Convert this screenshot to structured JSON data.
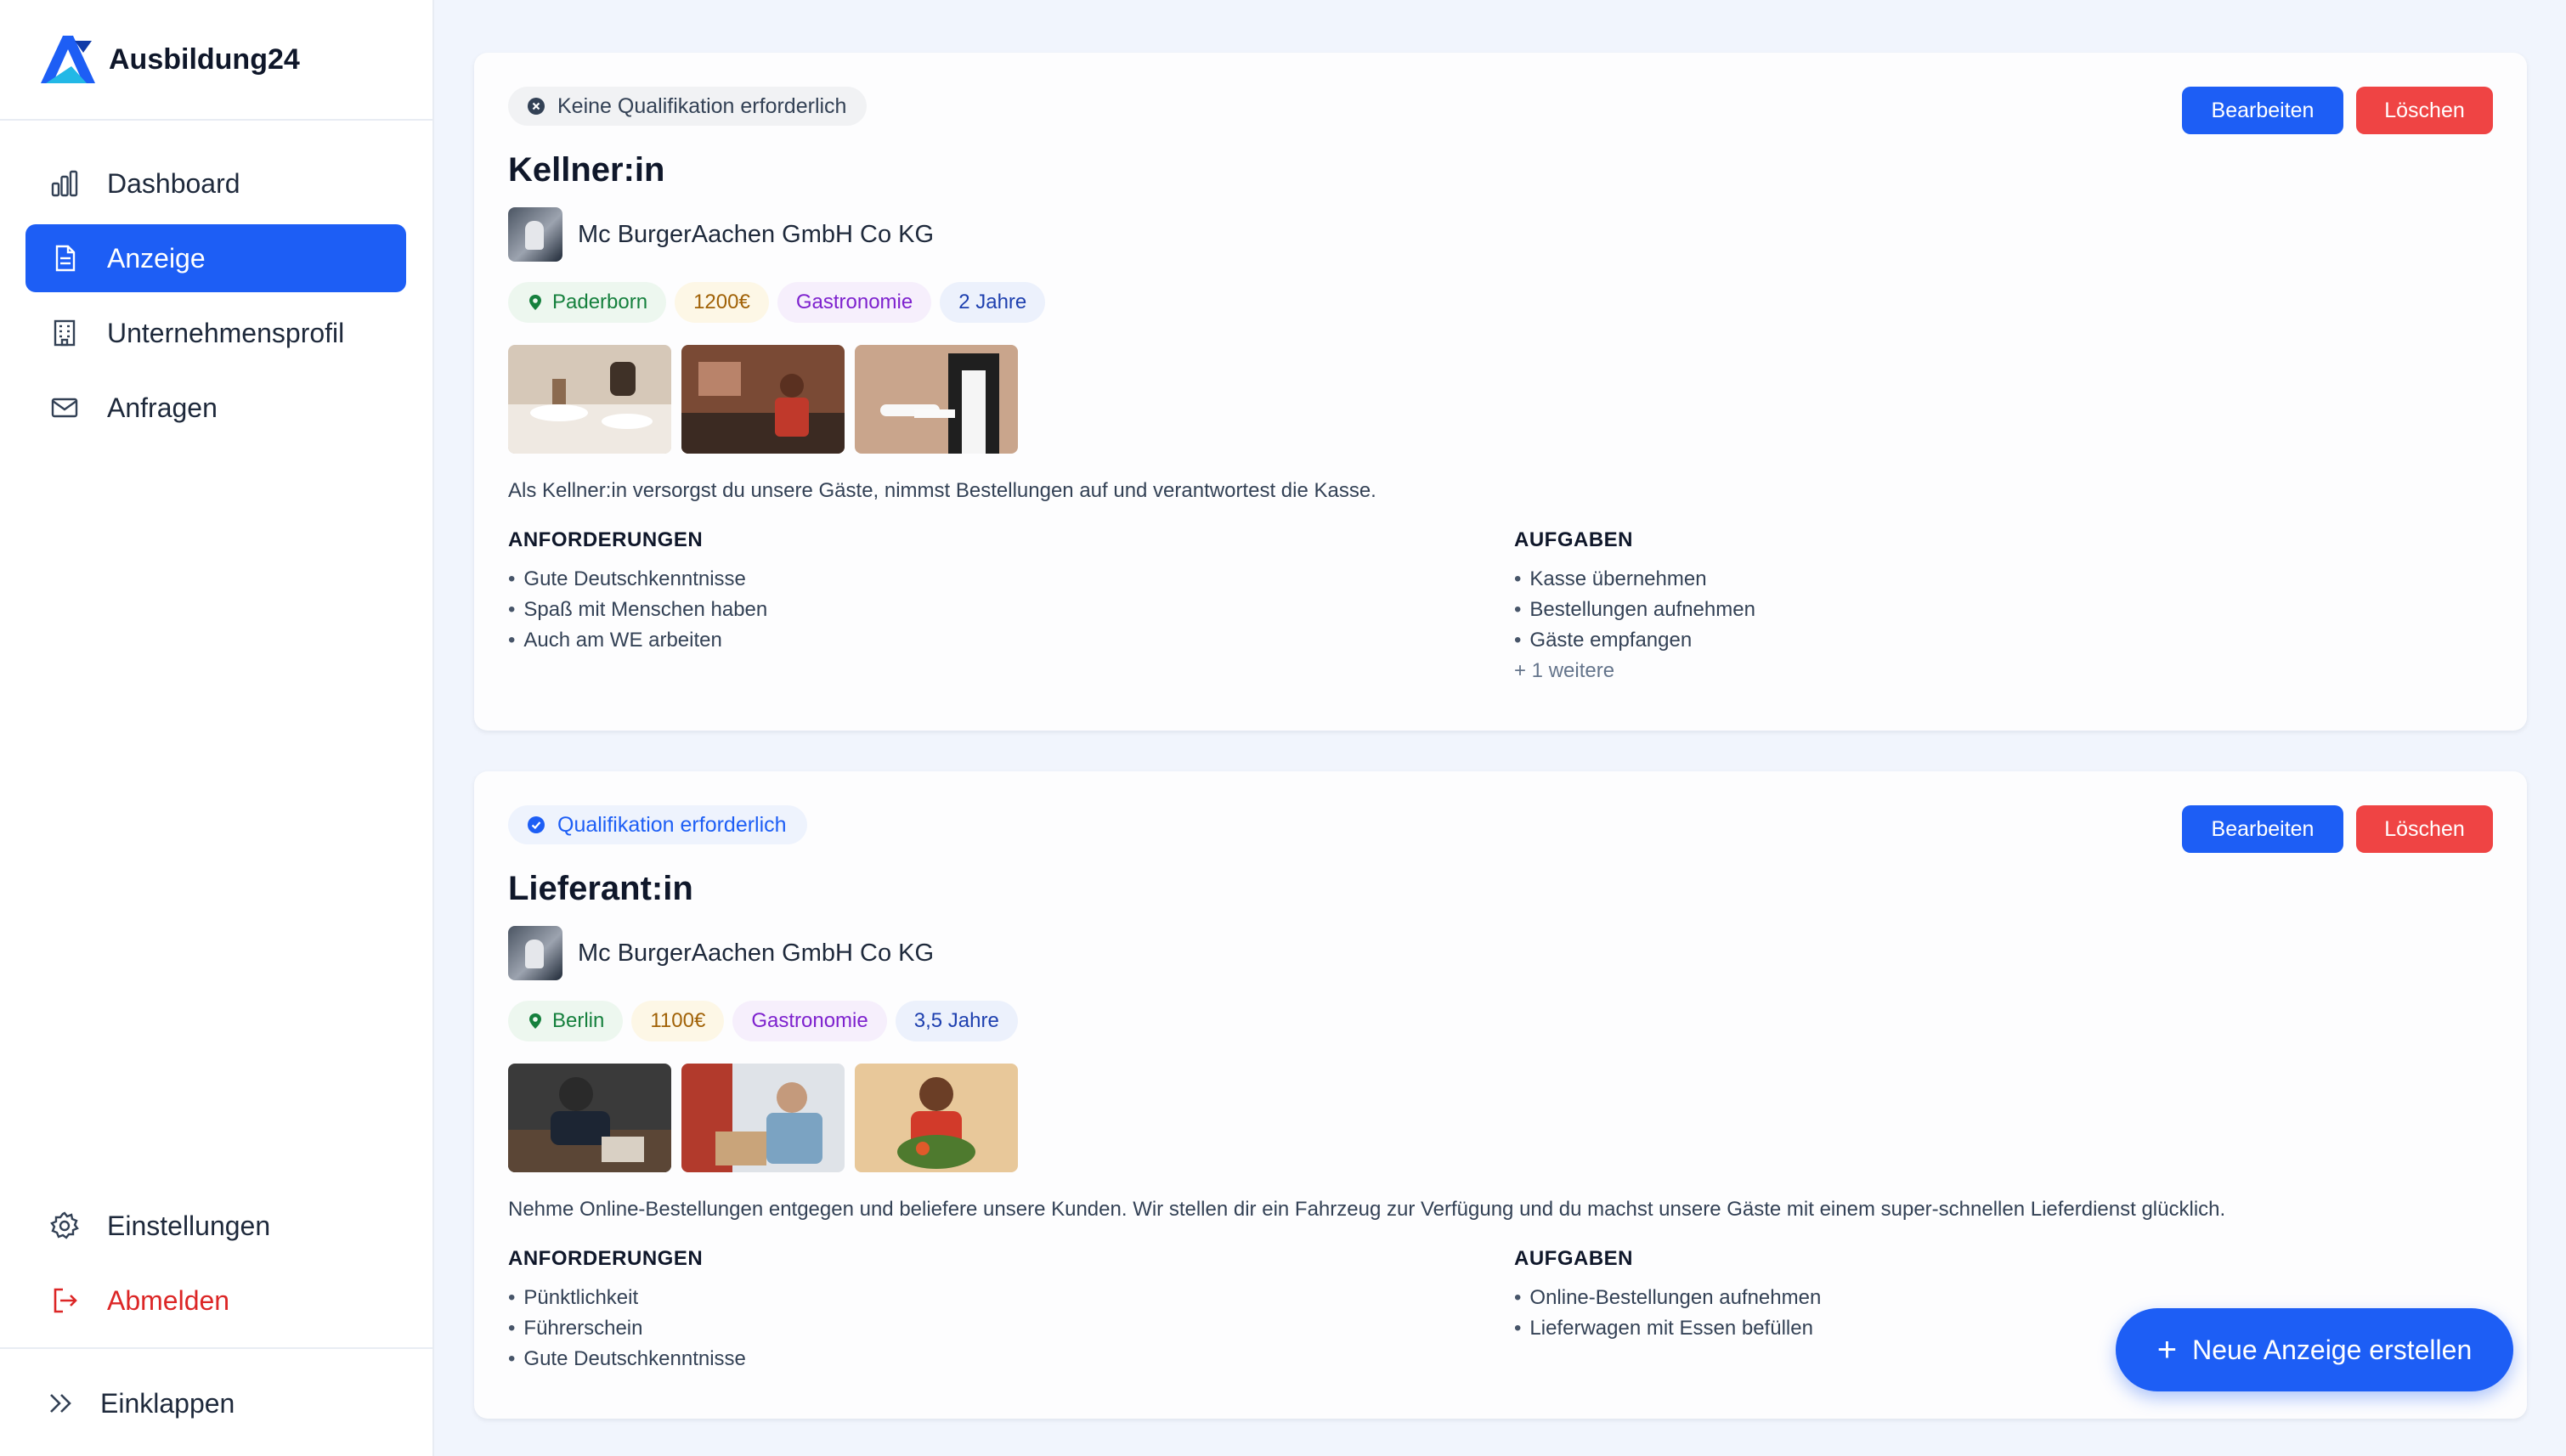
{
  "app": {
    "name": "Ausbildung24"
  },
  "sidebar": {
    "items": [
      {
        "label": "Dashboard",
        "icon": "bar-chart-icon"
      },
      {
        "label": "Anzeige",
        "icon": "document-icon",
        "active": true
      },
      {
        "label": "Unternehmensprofil",
        "icon": "building-icon"
      },
      {
        "label": "Anfragen",
        "icon": "mail-icon"
      }
    ],
    "settings_label": "Einstellungen",
    "logout_label": "Abmelden",
    "collapse_label": "Einklappen"
  },
  "actions": {
    "edit_label": "Bearbeiten",
    "delete_label": "Löschen"
  },
  "listings": [
    {
      "qualification": "Keine Qualifikation erforderlich",
      "title": "Kellner:in",
      "company": "Mc BurgerAachen GmbH Co KG",
      "location": "Paderborn",
      "salary": "1200€",
      "category": "Gastronomie",
      "duration": "2 Jahre",
      "description": "Als Kellner:in versorgst du unsere Gäste, nimmst Bestellungen auf und verantwortest die Kasse.",
      "requirements_heading": "ANFORDERUNGEN",
      "requirements": [
        "Gute Deutschkenntnisse",
        "Spaß mit Menschen haben",
        "Auch am WE arbeiten"
      ],
      "tasks_heading": "AUFGABEN",
      "tasks": [
        "Kasse übernehmen",
        "Bestellungen aufnehmen",
        "Gäste empfangen"
      ],
      "tasks_more": "+ 1 weitere"
    },
    {
      "qualification": "Qualifikation erforderlich",
      "title": "Lieferant:in",
      "company": "Mc BurgerAachen GmbH Co KG",
      "location": "Berlin",
      "salary": "1100€",
      "category": "Gastronomie",
      "duration": "3,5 Jahre",
      "description": "Nehme Online-Bestellungen entgegen und beliefere unsere Kunden. Wir stellen dir ein Fahrzeug zur Verfügung und du machst unsere Gäste mit einem super-schnellen Lieferdienst glücklich.",
      "requirements_heading": "ANFORDERUNGEN",
      "requirements": [
        "Pünktlichkeit",
        "Führerschein",
        "Gute Deutschkenntnisse"
      ],
      "tasks_heading": "AUFGABEN",
      "tasks": [
        "Online-Bestellungen aufnehmen",
        "Lieferwagen mit Essen befüllen"
      ]
    }
  ],
  "fab": {
    "plus": "+",
    "label": "Neue Anzeige erstellen"
  },
  "colors": {
    "accent": "#1d5ef5",
    "danger": "#ef4444",
    "background": "#f1f5fd"
  }
}
